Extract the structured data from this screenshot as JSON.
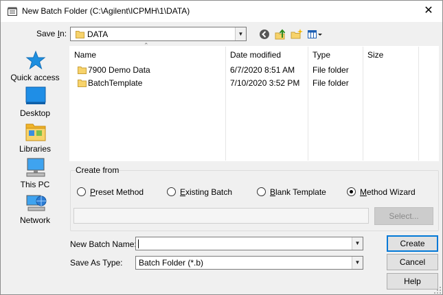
{
  "window": {
    "title": "New Batch Folder (C:\\Agilent\\ICPMH\\1\\DATA)",
    "close_glyph": "✕"
  },
  "save_in": {
    "label_pre": "Save ",
    "label_ul": "I",
    "label_post": "n:",
    "value": "DATA"
  },
  "toolbar": {
    "icons": [
      "back-icon",
      "up-folder-icon",
      "new-folder-icon",
      "view-menu-icon"
    ]
  },
  "places": [
    {
      "label": "Quick access",
      "icon": "star-icon"
    },
    {
      "label": "Desktop",
      "icon": "desktop-icon"
    },
    {
      "label": "Libraries",
      "icon": "libraries-icon"
    },
    {
      "label": "This PC",
      "icon": "computer-icon"
    },
    {
      "label": "Network",
      "icon": "network-icon"
    }
  ],
  "file_list": {
    "columns": [
      "Name",
      "Date modified",
      "Type",
      "Size"
    ],
    "rows": [
      {
        "name": "7900 Demo Data",
        "date": "6/7/2020 8:51 AM",
        "type": "File folder",
        "size": ""
      },
      {
        "name": "BatchTemplate",
        "date": "7/10/2020 3:52 PM",
        "type": "File folder",
        "size": ""
      }
    ]
  },
  "create_from": {
    "label": "Create from",
    "options": [
      {
        "ul": "P",
        "rest": "reset Method",
        "selected": false
      },
      {
        "ul": "E",
        "rest": "xisting Batch",
        "selected": false
      },
      {
        "ul": "B",
        "rest": "lank Template",
        "selected": false
      },
      {
        "ul": "M",
        "rest": "ethod Wizard",
        "selected": true
      }
    ],
    "path_value": "",
    "select_button": "Select..."
  },
  "batch_name": {
    "label": "New Batch Name:",
    "value": ""
  },
  "save_as_type": {
    "label": "Save As Type:",
    "value": "Batch Folder (*.b)"
  },
  "buttons": {
    "create": "Create",
    "cancel": "Cancel",
    "help": "Help"
  },
  "colors": {
    "accent": "#0078d7",
    "folder": "#f7d36b",
    "window_bg": "#f0f0f0"
  }
}
